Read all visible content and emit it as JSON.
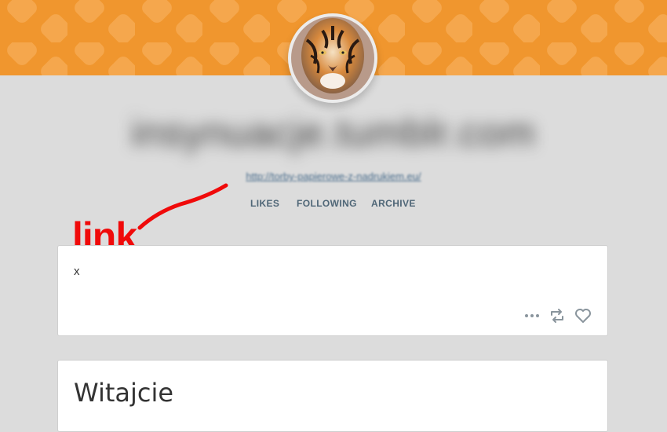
{
  "blog": {
    "title": "insynuacje.tumblr.com",
    "description_link": "http://torby-papierowe-z-nadrukiem.eu/"
  },
  "nav": {
    "likes": "LIKES",
    "following": "FOLLOWING",
    "archive": "ARCHIVE"
  },
  "annotation": {
    "label": "link",
    "color": "#f00a0a"
  },
  "posts": [
    {
      "body": "x",
      "actions": [
        "more-icon",
        "reblog-icon",
        "like-icon"
      ]
    },
    {
      "heading": "Witajcie"
    }
  ],
  "colors": {
    "header": "#f0962e",
    "background": "#dcdcdc",
    "nav_text": "#4f6677"
  }
}
